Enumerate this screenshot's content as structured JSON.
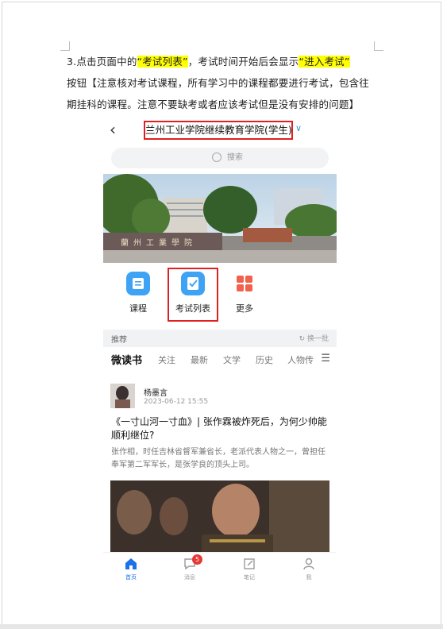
{
  "doc": {
    "line1_prefix": "3.点击页面中的",
    "line1_hl1": "“考试列表”",
    "line1_mid": "，考试时间开始后会显示",
    "line1_hl2": "“进入考试”",
    "line2": "按钮【注意核对考试课程，所有学习中的课程都要进行考试，包含往",
    "line3": "期挂科的课程。注意不要缺考或者应该考试但是没有安排的问题】"
  },
  "phone": {
    "back_icon": "chevron-left-icon",
    "title": "兰州工业学院继续教育学院(学生)",
    "search_placeholder": "搜索",
    "banner_sign": "蘭州工業學院",
    "quick": [
      {
        "label": "课程",
        "icon": "course-icon",
        "color": "#3ea2f5"
      },
      {
        "label": "考试列表",
        "icon": "exam-icon",
        "color": "#3ea2f5"
      },
      {
        "label": "更多",
        "icon": "more-grid-icon",
        "color": "#f0624d"
      }
    ],
    "recommend_label": "推荐",
    "refresh_label": "换一批",
    "tabs": [
      "微读书",
      "关注",
      "最新",
      "文学",
      "历史",
      "人物传"
    ],
    "article": {
      "author": "杨墨言",
      "date": "2023-06-12 15:55",
      "headline": "《一寸山河一寸血》| 张作霖被炸死后，为何少帅能顺利继位?",
      "summary": "张作相，时任吉林省督军兼省长，老派代表人物之一，曾担任奉军第二军军长，是张学良的顶头上司。"
    },
    "bottom_nav": [
      {
        "label": "首页",
        "icon": "home-icon"
      },
      {
        "label": "消息",
        "icon": "message-icon",
        "badge": "5"
      },
      {
        "label": "笔记",
        "icon": "note-icon"
      },
      {
        "label": "我",
        "icon": "profile-icon"
      }
    ]
  }
}
